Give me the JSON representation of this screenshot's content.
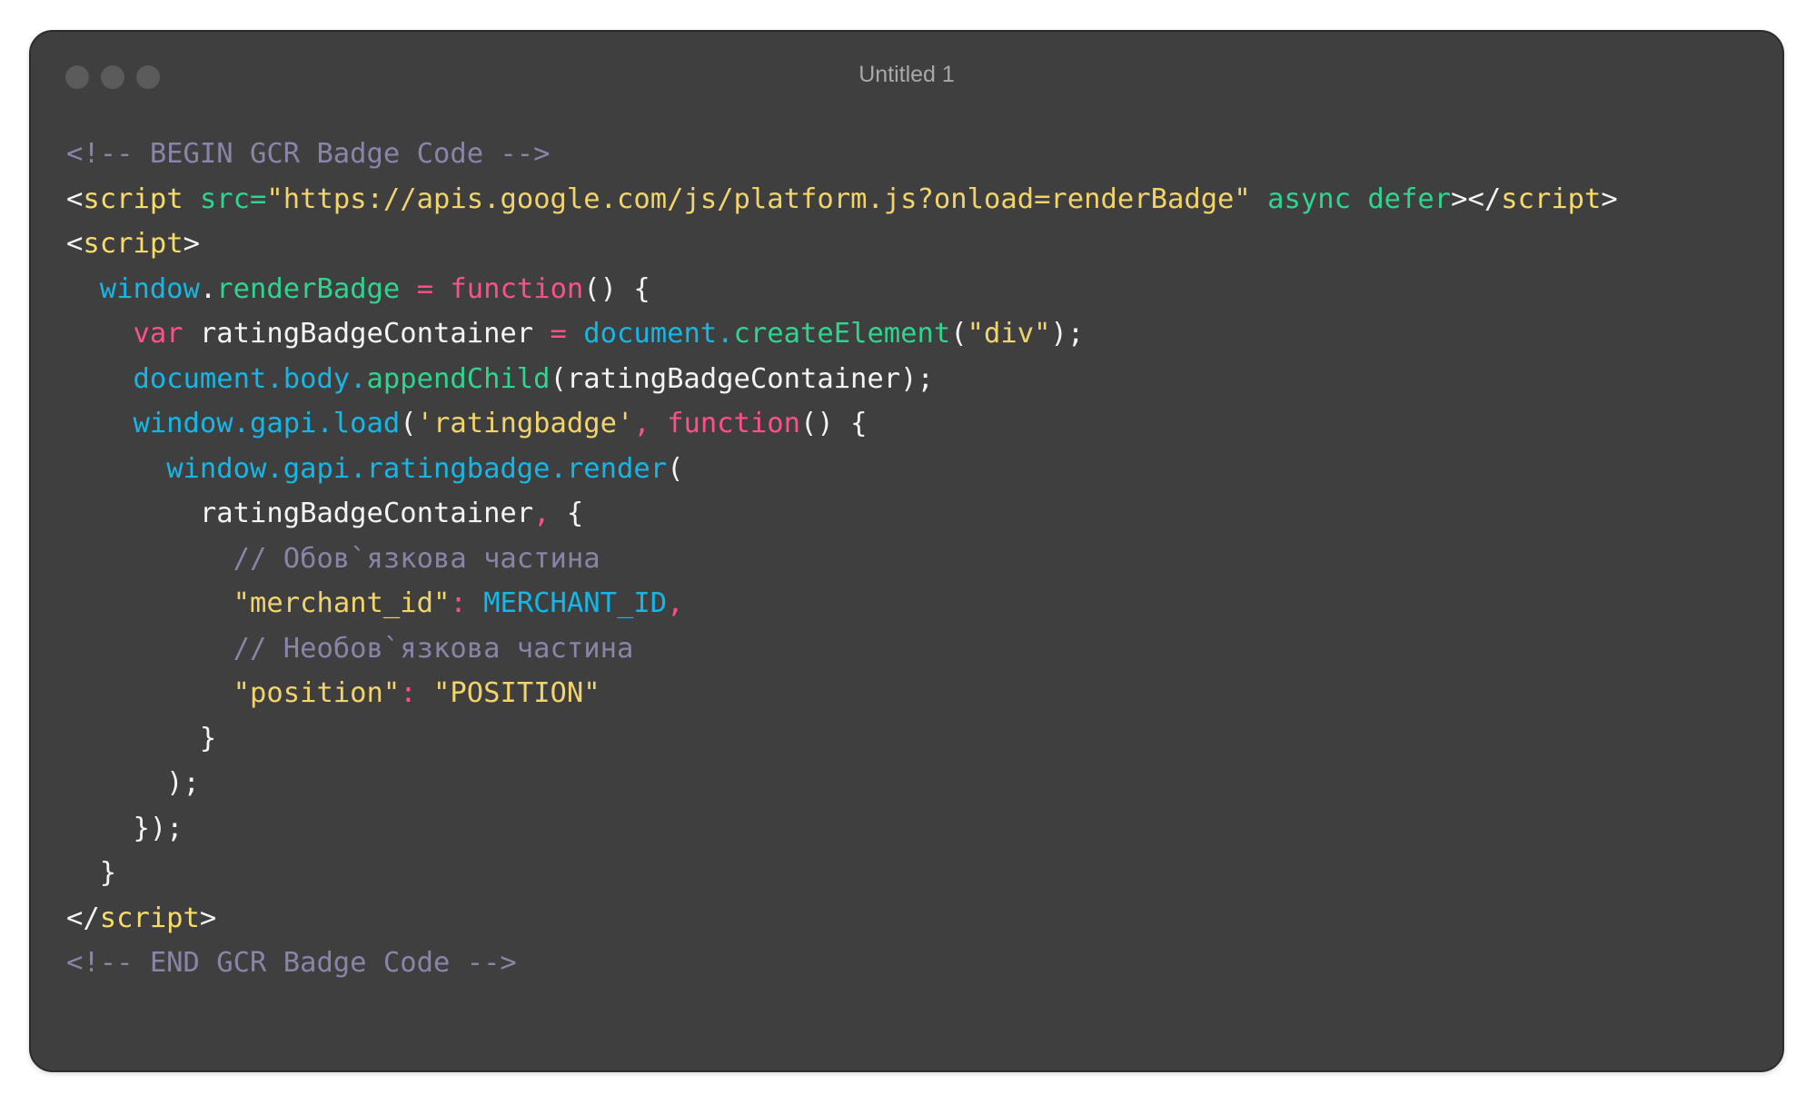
{
  "window": {
    "title": "Untitled 1",
    "traffic_lights": [
      "close",
      "minimize",
      "zoom"
    ]
  },
  "colors": {
    "comment": "#8a84a8",
    "keyword_tag": "#f7dc6a",
    "attribute": "#2fd58f",
    "string": "#f1d46b",
    "object": "#16b6e6",
    "function_keyword": "#ff4f8b",
    "plain": "#f4f4f4",
    "background": "#3f3f3f"
  },
  "code": {
    "lines": [
      [
        {
          "t": "<!-- BEGIN GCR Badge Code -->",
          "c": "comment"
        }
      ],
      [
        {
          "t": "<",
          "c": "plain"
        },
        {
          "t": "script",
          "c": "keyword"
        },
        {
          "t": " ",
          "c": "plain"
        },
        {
          "t": "src=",
          "c": "attr"
        },
        {
          "t": "\"https://apis.google.com/js/platform.js?onload=renderBadge\"",
          "c": "string"
        },
        {
          "t": " async defer",
          "c": "attr"
        },
        {
          "t": "></",
          "c": "plain"
        },
        {
          "t": "script",
          "c": "keyword"
        },
        {
          "t": ">",
          "c": "plain"
        }
      ],
      [
        {
          "t": "<",
          "c": "plain"
        },
        {
          "t": "script",
          "c": "keyword"
        },
        {
          "t": ">",
          "c": "plain"
        }
      ],
      [
        {
          "t": "  ",
          "c": "plain"
        },
        {
          "t": "window",
          "c": "obj"
        },
        {
          "t": ".",
          "c": "plain"
        },
        {
          "t": "renderBadge",
          "c": "method"
        },
        {
          "t": " = ",
          "c": "fn"
        },
        {
          "t": "function",
          "c": "fn"
        },
        {
          "t": "() {",
          "c": "plain"
        }
      ],
      [
        {
          "t": "    ",
          "c": "plain"
        },
        {
          "t": "var",
          "c": "fn"
        },
        {
          "t": " ratingBadgeContainer ",
          "c": "plain"
        },
        {
          "t": "=",
          "c": "fn"
        },
        {
          "t": " ",
          "c": "plain"
        },
        {
          "t": "document.",
          "c": "obj"
        },
        {
          "t": "createElement",
          "c": "method"
        },
        {
          "t": "(",
          "c": "plain"
        },
        {
          "t": "\"div\"",
          "c": "string"
        },
        {
          "t": ");",
          "c": "plain"
        }
      ],
      [
        {
          "t": "    ",
          "c": "plain"
        },
        {
          "t": "document.body.",
          "c": "obj"
        },
        {
          "t": "appendChild",
          "c": "method"
        },
        {
          "t": "(ratingBadgeContainer);",
          "c": "plain"
        }
      ],
      [
        {
          "t": "    ",
          "c": "plain"
        },
        {
          "t": "window.gapi.load",
          "c": "obj"
        },
        {
          "t": "(",
          "c": "plain"
        },
        {
          "t": "'ratingbadge'",
          "c": "string"
        },
        {
          "t": ", ",
          "c": "fn"
        },
        {
          "t": "function",
          "c": "fn"
        },
        {
          "t": "() {",
          "c": "plain"
        }
      ],
      [
        {
          "t": "      ",
          "c": "plain"
        },
        {
          "t": "window.gapi.ratingbadge.render",
          "c": "obj"
        },
        {
          "t": "(",
          "c": "plain"
        }
      ],
      [
        {
          "t": "        ratingBadgeContainer",
          "c": "plain"
        },
        {
          "t": ",",
          "c": "fn"
        },
        {
          "t": " {",
          "c": "plain"
        }
      ],
      [
        {
          "t": "          // Обов`язкова частина",
          "c": "comment"
        }
      ],
      [
        {
          "t": "          ",
          "c": "plain"
        },
        {
          "t": "\"merchant_id\"",
          "c": "string"
        },
        {
          "t": ": ",
          "c": "fn"
        },
        {
          "t": "MERCHANT_ID",
          "c": "const"
        },
        {
          "t": ",",
          "c": "fn"
        }
      ],
      [
        {
          "t": "          // Необов`язкова частина",
          "c": "comment"
        }
      ],
      [
        {
          "t": "          ",
          "c": "plain"
        },
        {
          "t": "\"position\"",
          "c": "string"
        },
        {
          "t": ": ",
          "c": "fn"
        },
        {
          "t": "\"POSITION\"",
          "c": "string"
        }
      ],
      [
        {
          "t": "        }",
          "c": "plain"
        }
      ],
      [
        {
          "t": "      );",
          "c": "plain"
        }
      ],
      [
        {
          "t": "    });",
          "c": "plain"
        }
      ],
      [
        {
          "t": "  }",
          "c": "plain"
        }
      ],
      [
        {
          "t": "</",
          "c": "plain"
        },
        {
          "t": "script",
          "c": "keyword"
        },
        {
          "t": ">",
          "c": "plain"
        }
      ],
      [
        {
          "t": "<!-- END GCR Badge Code -->",
          "c": "comment"
        }
      ]
    ]
  }
}
